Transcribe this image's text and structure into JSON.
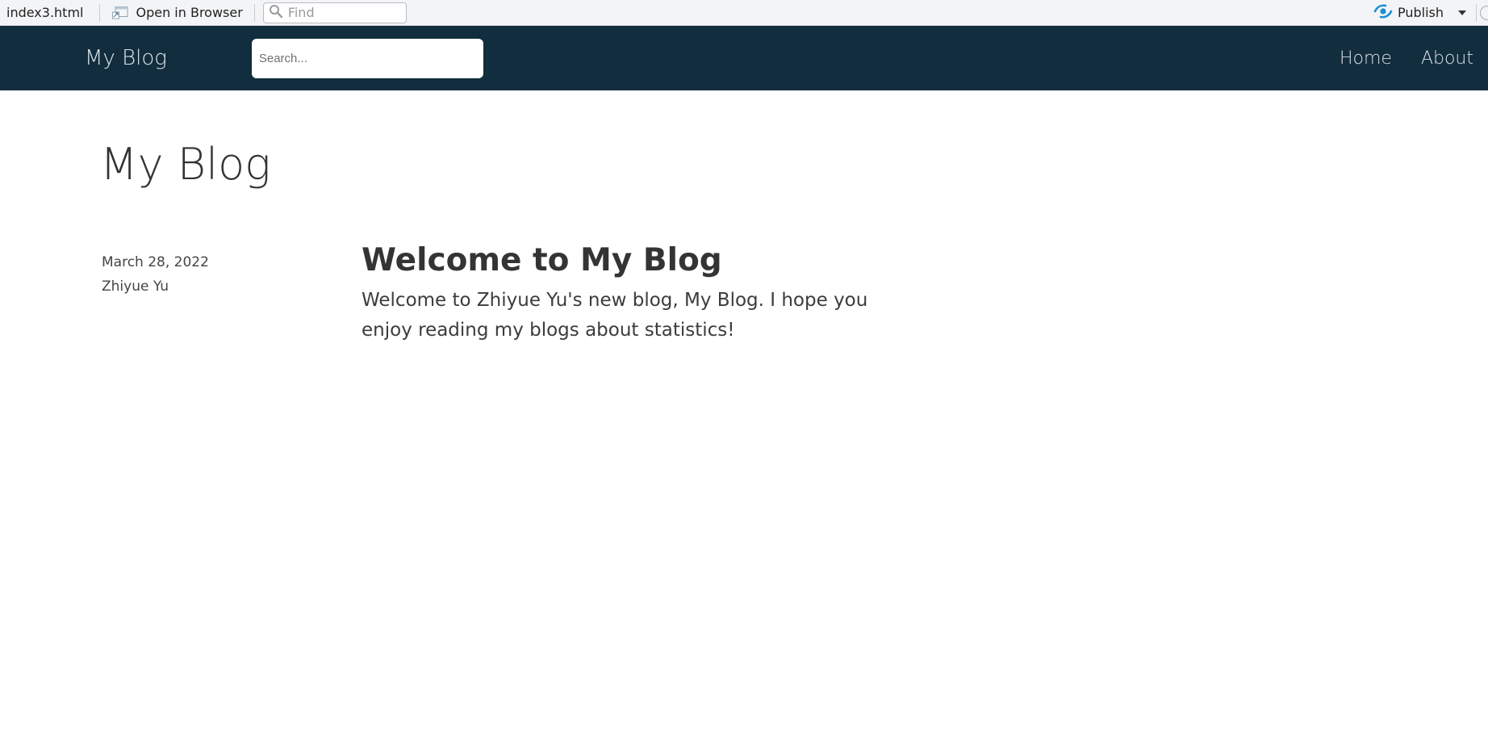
{
  "viewer_toolbar": {
    "filename": "index3.html",
    "open_in_browser_label": "Open in Browser",
    "find_placeholder": "Find",
    "publish_label": "Publish"
  },
  "navbar": {
    "brand": "My Blog",
    "search_placeholder": "Search...",
    "links": [
      {
        "label": "Home"
      },
      {
        "label": "About"
      }
    ],
    "background_color": "#112d3e"
  },
  "page": {
    "title": "My Blog"
  },
  "posts": [
    {
      "date": "March 28, 2022",
      "author": "Zhiyue Yu",
      "title": "Welcome to My Blog",
      "excerpt": "Welcome to Zhiyue Yu's new blog, My Blog. I hope you enjoy reading my blogs about statistics!"
    }
  ],
  "icons": {
    "open_in_browser": "browser-window-icon",
    "find": "search-icon",
    "publish": "publish-icon",
    "publish_menu": "chevron-down-icon"
  },
  "colors": {
    "publish_icon": "#1a8fd6",
    "text_primary": "#333333"
  }
}
